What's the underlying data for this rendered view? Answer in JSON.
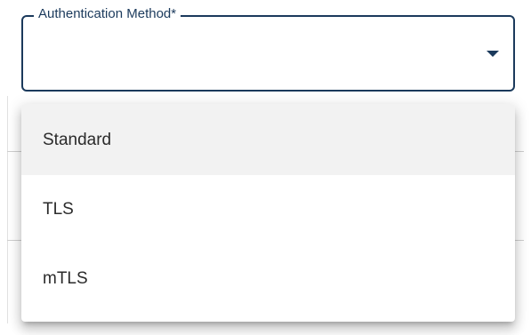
{
  "field": {
    "label": "Authentication Method*",
    "value": ""
  },
  "menu": {
    "items": [
      {
        "label": "Standard",
        "highlighted": true
      },
      {
        "label": "TLS",
        "highlighted": false
      },
      {
        "label": "mTLS",
        "highlighted": false
      }
    ]
  },
  "colors": {
    "accent": "#1b3a5c",
    "highlight": "#f2f2f2",
    "text": "#2b2b2b"
  },
  "icons": {
    "caret": "chevron-down-icon"
  }
}
